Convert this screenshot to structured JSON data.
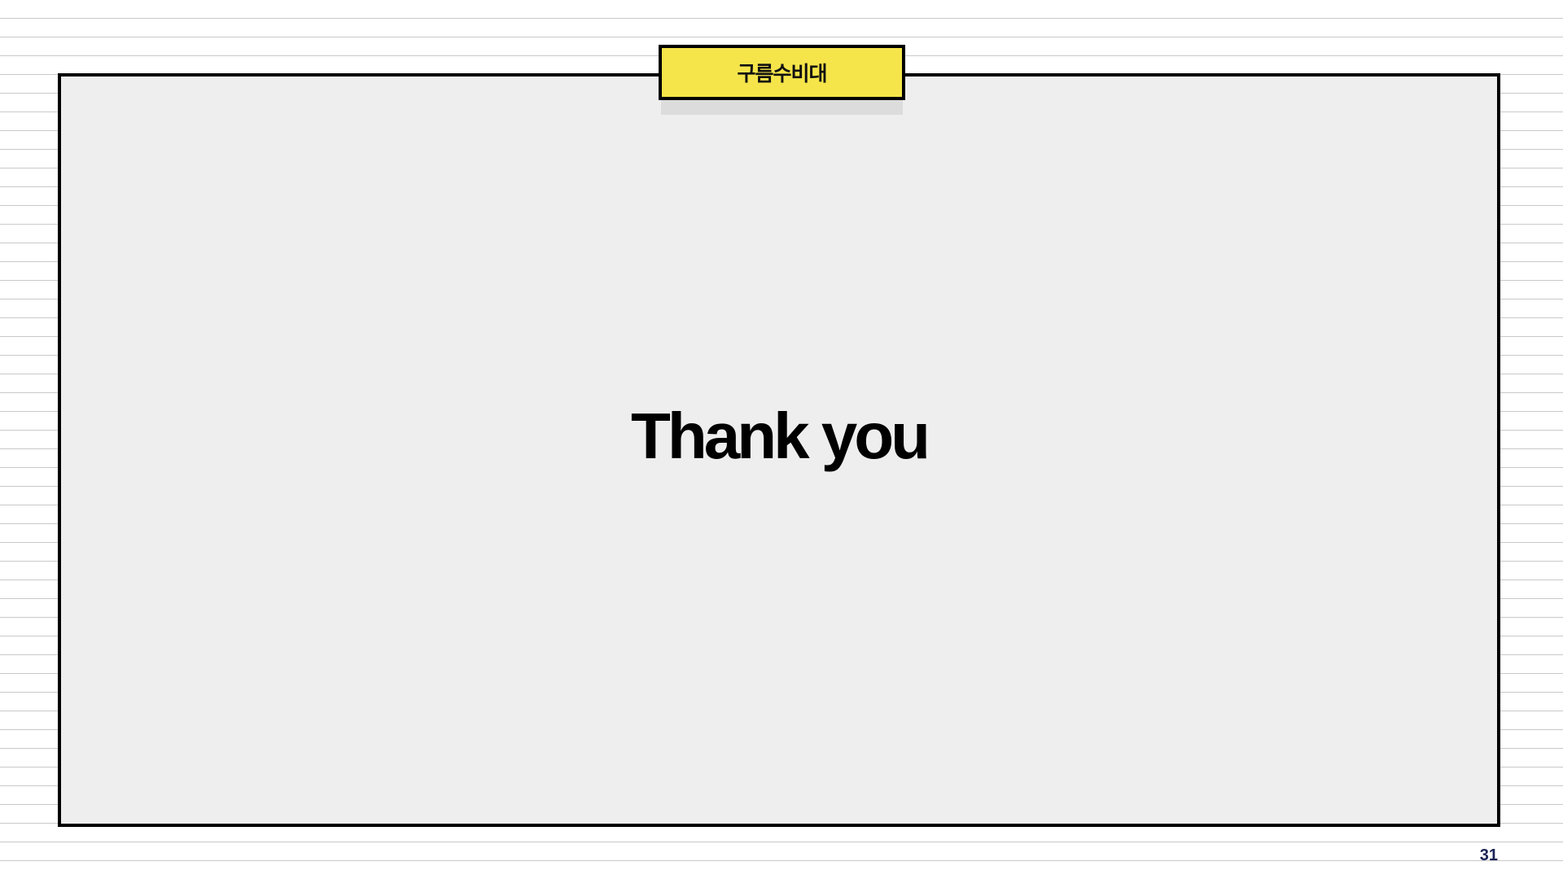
{
  "slide": {
    "tag_label": "구름수비대",
    "headline": "Thank you",
    "page_number": "31"
  },
  "colors": {
    "tag_background": "#f5e54a",
    "frame_background": "#eeeeee",
    "border": "#000000",
    "page_number": "#1a2456"
  }
}
